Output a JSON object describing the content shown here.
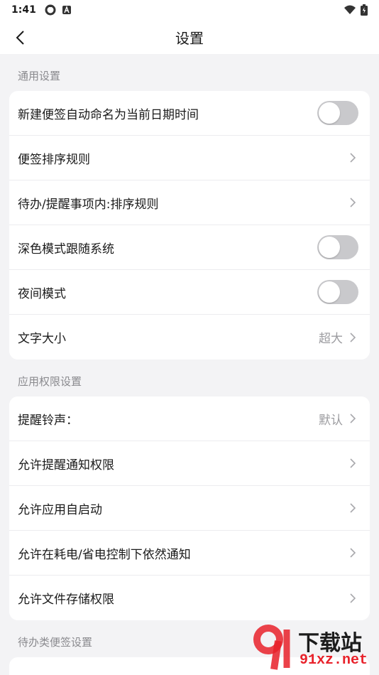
{
  "status_bar": {
    "time": "1:41",
    "colors": {
      "icon": "#333333"
    }
  },
  "app_bar": {
    "title": "设置"
  },
  "sections": [
    {
      "label": "通用设置",
      "rows": [
        {
          "label": "新建便签自动命名为当前日期时间",
          "control": "toggle",
          "on": false
        },
        {
          "label": "便签排序规则",
          "control": "chevron"
        },
        {
          "label": "待办/提醒事项内:排序规则",
          "control": "chevron"
        },
        {
          "label": "深色模式跟随系统",
          "control": "toggle",
          "on": false
        },
        {
          "label": "夜间模式",
          "control": "toggle",
          "on": false
        },
        {
          "label": "文字大小",
          "control": "chevron",
          "value": "超大"
        }
      ]
    },
    {
      "label": "应用权限设置",
      "rows": [
        {
          "label": "提醒铃声：",
          "control": "chevron",
          "value": "默认"
        },
        {
          "label": "允许提醒通知权限",
          "control": "chevron"
        },
        {
          "label": "允许应用自启动",
          "control": "chevron"
        },
        {
          "label": "允许在耗电/省电控制下依然通知",
          "control": "chevron"
        },
        {
          "label": "允许文件存储权限",
          "control": "chevron"
        }
      ]
    },
    {
      "label": "待办类便签设置",
      "rows": []
    }
  ],
  "watermark": {
    "title": "下载站",
    "url": "91xz.net"
  },
  "colors": {
    "background": "#f3f3f5",
    "toggle_off": "#c9c9cc",
    "watermark_red": "#e8212a"
  }
}
